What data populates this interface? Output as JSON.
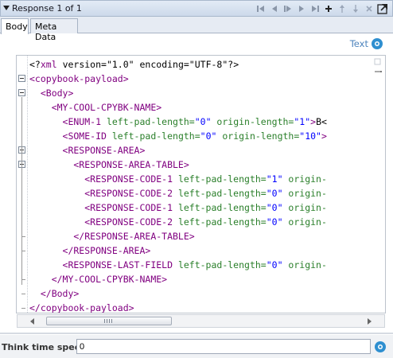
{
  "panel": {
    "title": "Response 1 of 1",
    "toolbar_icons": [
      "first-icon",
      "previous-icon",
      "next-icon",
      "play-icon",
      "last-icon",
      "add-icon",
      "move-up-icon",
      "move-down-icon",
      "delete-icon",
      "external-open-icon"
    ]
  },
  "tabs": [
    {
      "label": "Body",
      "active": true
    },
    {
      "label": "Meta Data",
      "active": false
    }
  ],
  "view_mode": {
    "label": "Text"
  },
  "editor": {
    "lines": [
      {
        "parts": [
          [
            "pi",
            "<?"
          ],
          [
            "tag",
            "xml"
          ],
          [
            "txt",
            " version=\"1.0\" encoding=\"UTF-8\""
          ],
          [
            "pi",
            "?>"
          ]
        ]
      },
      {
        "parts": [
          [
            "tag",
            "<copybook-payload>"
          ]
        ]
      },
      {
        "parts": [
          [
            "tag",
            "  <Body>"
          ]
        ]
      },
      {
        "parts": [
          [
            "tag",
            "    <MY-COOL-CPYBK-NAME>"
          ]
        ]
      },
      {
        "parts": [
          [
            "tag",
            "      <ENUM-1"
          ],
          [
            "attr",
            " left-pad-length="
          ],
          [
            "val",
            "\"0\""
          ],
          [
            "attr",
            " origin-length="
          ],
          [
            "val",
            "\"1\""
          ],
          [
            "tag",
            ">"
          ],
          [
            "txt",
            "B<"
          ]
        ]
      },
      {
        "parts": [
          [
            "tag",
            "      <SOME-ID"
          ],
          [
            "attr",
            " left-pad-length="
          ],
          [
            "val",
            "\"0\""
          ],
          [
            "attr",
            " origin-length="
          ],
          [
            "val",
            "\"10\""
          ],
          [
            "tag",
            ">"
          ]
        ]
      },
      {
        "parts": [
          [
            "tag",
            "      <RESPONSE-AREA>"
          ]
        ]
      },
      {
        "parts": [
          [
            "tag",
            "        <RESPONSE-AREA-TABLE>"
          ]
        ]
      },
      {
        "parts": [
          [
            "tag",
            "          <RESPONSE-CODE-1"
          ],
          [
            "attr",
            " left-pad-length="
          ],
          [
            "val",
            "\"1\""
          ],
          [
            "attr",
            " origin-"
          ]
        ]
      },
      {
        "parts": [
          [
            "tag",
            "          <RESPONSE-CODE-2"
          ],
          [
            "attr",
            " left-pad-length="
          ],
          [
            "val",
            "\"0\""
          ],
          [
            "attr",
            " origin-"
          ]
        ]
      },
      {
        "parts": [
          [
            "tag",
            "          <RESPONSE-CODE-1"
          ],
          [
            "attr",
            " left-pad-length="
          ],
          [
            "val",
            "\"0\""
          ],
          [
            "attr",
            " origin-"
          ]
        ]
      },
      {
        "parts": [
          [
            "tag",
            "          <RESPONSE-CODE-2"
          ],
          [
            "attr",
            " left-pad-length="
          ],
          [
            "val",
            "\"0\""
          ],
          [
            "attr",
            " origin-"
          ]
        ]
      },
      {
        "parts": [
          [
            "tag",
            "        </RESPONSE-AREA-TABLE>"
          ]
        ]
      },
      {
        "parts": [
          [
            "tag",
            "      </RESPONSE-AREA>"
          ]
        ]
      },
      {
        "parts": [
          [
            "tag",
            "      <RESPONSE-LAST-FIELD"
          ],
          [
            "attr",
            " left-pad-length="
          ],
          [
            "val",
            "\"0\""
          ],
          [
            "attr",
            " origin-"
          ]
        ]
      },
      {
        "parts": [
          [
            "tag",
            "    </MY-COOL-CPYBK-NAME>"
          ]
        ]
      },
      {
        "parts": [
          [
            "tag",
            "  </Body>"
          ]
        ]
      },
      {
        "parts": [
          [
            "tag",
            "</copybook-payload>"
          ]
        ]
      }
    ]
  },
  "think_time": {
    "label": "Think time spec:",
    "value": "0"
  }
}
